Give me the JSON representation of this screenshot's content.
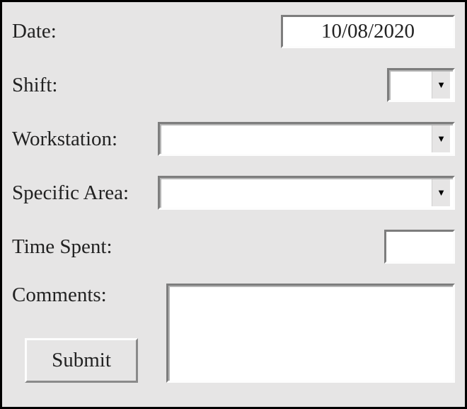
{
  "fields": {
    "date": {
      "label": "Date:",
      "value": "10/08/2020"
    },
    "shift": {
      "label": "Shift:",
      "value": ""
    },
    "workstation": {
      "label": "Workstation:",
      "value": ""
    },
    "specific_area": {
      "label": "Specific Area:",
      "value": ""
    },
    "time_spent": {
      "label": "Time Spent:",
      "value": ""
    },
    "comments": {
      "label": "Comments:",
      "value": ""
    }
  },
  "buttons": {
    "submit": "Submit"
  },
  "icons": {
    "dropdown_arrow": "▼"
  }
}
